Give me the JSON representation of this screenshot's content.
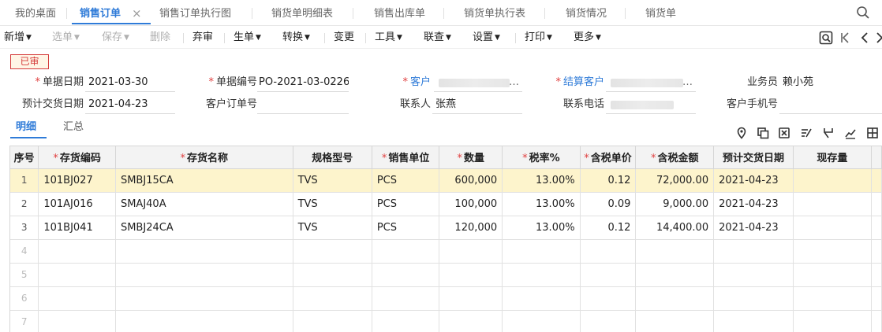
{
  "tabs": [
    {
      "label": "我的桌面"
    },
    {
      "label": "销售订单"
    },
    {
      "label": "销售订单执行图"
    },
    {
      "label": "销货单明细表"
    },
    {
      "label": "销售出库单"
    },
    {
      "label": "销货单执行表"
    },
    {
      "label": "销货情况"
    },
    {
      "label": "销货单"
    }
  ],
  "toolbar": {
    "new": "新增",
    "select_doc": "选单",
    "save": "保存",
    "delete": "删除",
    "abandon": "弃审",
    "generate": "生单",
    "convert": "转换",
    "change": "变更",
    "tools": "工具",
    "link_query": "联查",
    "settings": "设置",
    "print": "打印",
    "more": "更多"
  },
  "status_stamp": "已审",
  "form": {
    "doc_date_label": "单据日期",
    "doc_date": "2021-03-30",
    "doc_no_label": "单据编号",
    "doc_no": "PO-2021-03-0226",
    "customer_label": "客户",
    "settle_customer_label": "结算客户",
    "salesman_label": "业务员",
    "salesman": "赖小苑",
    "delivery_date_label": "预计交货日期",
    "delivery_date": "2021-04-23",
    "customer_order_label": "客户订单号",
    "customer_order": "",
    "contact_label": "联系人",
    "contact": "张燕",
    "contact_phone_label": "联系电话",
    "customer_mobile_label": "客户手机号",
    "customer_mobile": ""
  },
  "subtabs": {
    "detail": "明细",
    "summary": "汇总"
  },
  "table": {
    "headers": [
      "序号",
      "存货编码",
      "存货名称",
      "规格型号",
      "销售单位",
      "数量",
      "税率%",
      "含税单价",
      "含税金额",
      "预计交货日期",
      "现存量"
    ],
    "rows": [
      {
        "idx": "1",
        "code": "101BJ027",
        "name": "SMBJ15CA",
        "spec": "TVS",
        "unit": "PCS",
        "qty": "600,000",
        "tax": "13.00%",
        "price": "0.12",
        "amount": "72,000.00",
        "date": "2021-04-23",
        "stock": ""
      },
      {
        "idx": "2",
        "code": "101AJ016",
        "name": "SMAJ40A",
        "spec": "TVS",
        "unit": "PCS",
        "qty": "100,000",
        "tax": "13.00%",
        "price": "0.09",
        "amount": "9,000.00",
        "date": "2021-04-23",
        "stock": ""
      },
      {
        "idx": "3",
        "code": "101BJ041",
        "name": "SMBJ24CA",
        "spec": "TVS",
        "unit": "PCS",
        "qty": "120,000",
        "tax": "13.00%",
        "price": "0.12",
        "amount": "14,400.00",
        "date": "2021-04-23",
        "stock": ""
      }
    ],
    "empty_rows": [
      "4",
      "5",
      "6",
      "7"
    ]
  },
  "colors": {
    "accent": "#2f7bd8",
    "required": "#e04040",
    "selected_row": "#fdf4cc",
    "stamp": "#d43b3b"
  }
}
